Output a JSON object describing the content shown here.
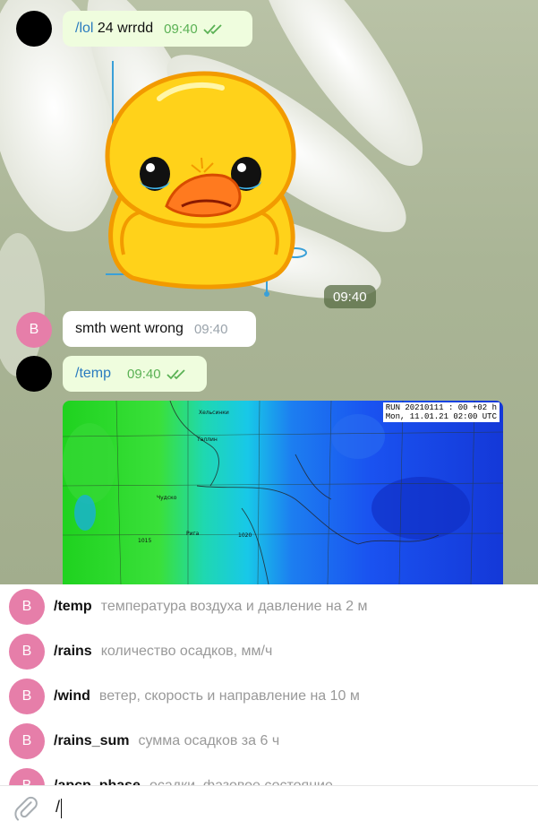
{
  "messages": [
    {
      "side": "out",
      "command": "/lol",
      "text": " 24 wrrdd",
      "time": "09:40"
    },
    {
      "side": "out",
      "kind": "sticker",
      "time": "09:40"
    },
    {
      "side": "in",
      "avatar": "B",
      "text": "smth went wrong",
      "time": "09:40"
    },
    {
      "side": "out",
      "command": "/temp",
      "text": "",
      "time": "09:40"
    },
    {
      "side": "out",
      "kind": "map-image",
      "label_line1": "RUN 20210111 : 00 +02 h",
      "label_line2": "Mon, 11.01.21 02:00 UTC"
    }
  ],
  "suggestions": [
    {
      "avatar": "B",
      "command": "/temp",
      "description": "температура воздуха и давление на 2 м"
    },
    {
      "avatar": "B",
      "command": "/rains",
      "description": "количество осадков, мм/ч"
    },
    {
      "avatar": "B",
      "command": "/wind",
      "description": "ветер, скорость и направление на 10 м"
    },
    {
      "avatar": "B",
      "command": "/rains_sum",
      "description": "сумма осадков за 6 ч"
    },
    {
      "avatar": "B",
      "command": "/apcp_phase",
      "description": "осадки, фазовое состояние"
    }
  ],
  "composer": {
    "value": "/"
  },
  "colors": {
    "outgoing_bubble": "#effdde",
    "incoming_bubble": "#ffffff",
    "command_link": "#2a7bbf",
    "read_ticks": "#5ab154",
    "bot_avatar": "#e67ea9"
  }
}
